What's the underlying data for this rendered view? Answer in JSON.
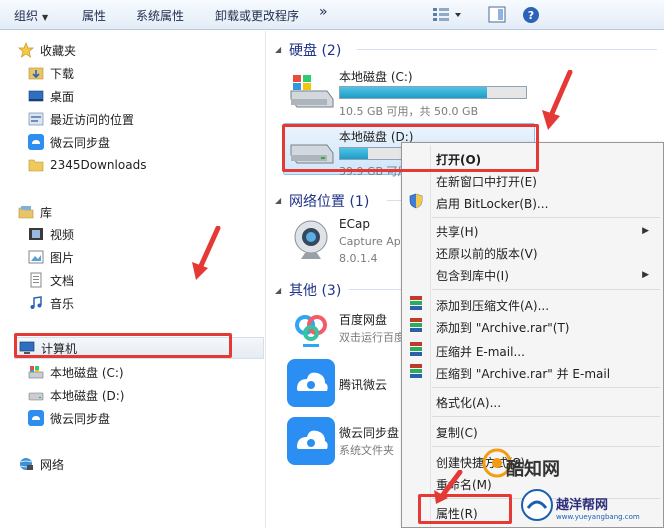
{
  "toolbar": {
    "organize": "组织",
    "properties": "属性",
    "system_properties": "系统属性",
    "uninstall": "卸载或更改程序",
    "more": "»"
  },
  "nav": {
    "favorites": "收藏夹",
    "downloads": "下载",
    "desktop": "桌面",
    "recent": "最近访问的位置",
    "weiyun_sync": "微云同步盘",
    "downloads2345": "2345Downloads",
    "libraries": "库",
    "videos": "视频",
    "pictures": "图片",
    "documents": "文档",
    "music": "音乐",
    "computer": "计算机",
    "drive_c": "本地磁盘 (C:)",
    "drive_d": "本地磁盘 (D:)",
    "weiyun_sync2": "微云同步盘",
    "network": "网络"
  },
  "content": {
    "hdd_header": "硬盘 (2)",
    "drive_c_name": "本地磁盘 (C:)",
    "drive_c_usage": "10.5 GB 可用，共 50.0 GB",
    "drive_c_used_fraction": 0.79,
    "drive_d_name": "本地磁盘 (D:)",
    "drive_d_usage": "39.9 GB 可用",
    "drive_d_used_fraction": 0.2,
    "net_header": "网络位置 (1)",
    "ecap_name": "ECap",
    "ecap_sub": "Capture Ap",
    "ecap_ver": "8.0.1.4",
    "other_header": "其他 (3)",
    "baidu_name": "百度网盘",
    "baidu_sub": "双击运行百度",
    "tencent_name": "腾讯微云",
    "weiyun_name": "微云同步盘",
    "weiyun_sub": "系统文件夹"
  },
  "menu": {
    "open": "打开(O)",
    "open_new_window": "在新窗口中打开(E)",
    "bitlocker": "启用 BitLocker(B)...",
    "share": "共享(H)",
    "restore": "还原以前的版本(V)",
    "include_library": "包含到库中(I)",
    "add_archive": "添加到压缩文件(A)...",
    "add_archive_rar": "添加到 \"Archive.rar\"(T)",
    "compress_email": "压缩并 E-mail...",
    "compress_rar_email": "压缩到 \"Archive.rar\" 并 E-mail",
    "format": "格式化(A)...",
    "copy": "复制(C)",
    "create_shortcut": "创建快捷方式(S)",
    "rename": "重命名(M)",
    "properties": "属性(R)"
  },
  "watermark": {
    "main": "酷知网",
    "sub": "越洋帮网",
    "url": "www.yueyangbang.com"
  },
  "colors": {
    "highlight": "#e53935",
    "accent": "#1e3287",
    "bar_fill": "#26a0da"
  }
}
